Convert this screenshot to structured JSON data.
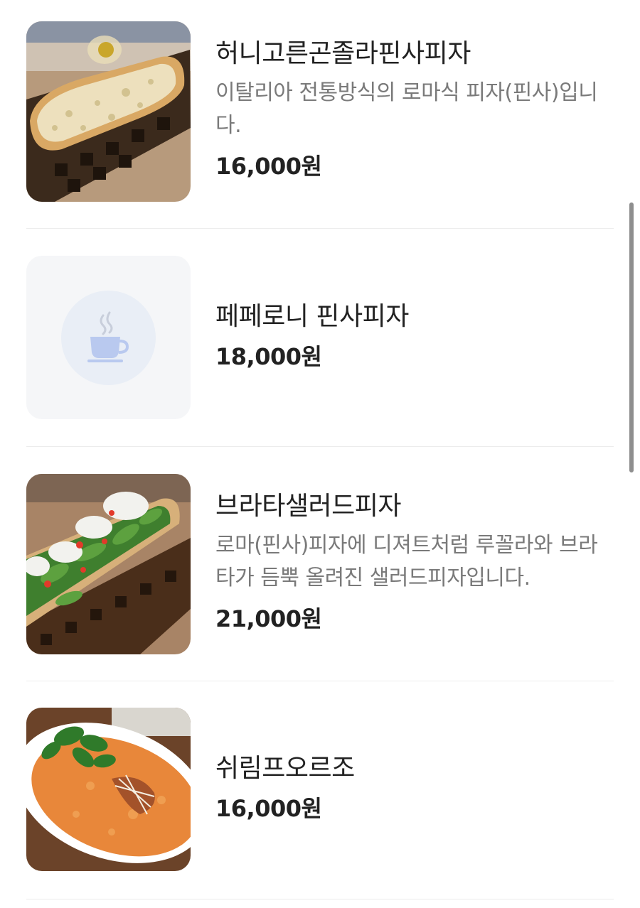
{
  "items": [
    {
      "name": "허니고른곤졸라핀사피자",
      "description": "이탈리아 전통방식의 로마식 피자(핀사)입니다.",
      "price": "16,000원",
      "image": "honey-gorgonzola-pinsa-photo"
    },
    {
      "name": "페페로니 핀사피자",
      "description": "",
      "price": "18,000원",
      "image": "coffee-cup-icon"
    },
    {
      "name": "브라타샐러드피자",
      "description": "로마(핀사)피자에 디져트처럼 루꼴라와 브라타가 듬뿍 올려진 샐러드피자입니다.",
      "price": "21,000원",
      "image": "burrata-salad-pizza-photo"
    },
    {
      "name": "쉬림프오르조",
      "description": "",
      "price": "16,000원",
      "image": "shrimp-orzo-photo"
    }
  ]
}
